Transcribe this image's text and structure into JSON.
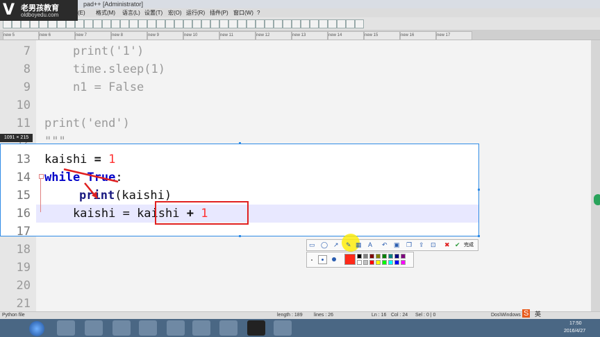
{
  "window": {
    "title": "pad++ [Administrator]"
  },
  "logo": {
    "mark": "V",
    "name": "老男孩教育",
    "url": "oldboyedu.com"
  },
  "menu": [
    "(E)",
    "格式(M)",
    "语言(L)",
    "设置(T)",
    "宏(O)",
    "运行(R)",
    "插件(P)",
    "窗口(W)",
    "?"
  ],
  "tabs": [
    "new 5",
    "new 6",
    "new 7",
    "new 8",
    "new 9",
    "new 10",
    "new 11",
    "new 12",
    "new 13",
    "new 14",
    "new 15",
    "new 16",
    "new 17"
  ],
  "editor": {
    "lines_above": [
      {
        "num": "7",
        "text": "    print('1')"
      },
      {
        "num": "8",
        "text": "    time.sleep(1)"
      },
      {
        "num": "9",
        "text": "    n1 = False"
      },
      {
        "num": "10",
        "text": ""
      },
      {
        "num": "11",
        "text": "print('end')"
      },
      {
        "num": "12",
        "text": "\"\"\""
      }
    ],
    "capture_lines": [
      {
        "num": "13"
      },
      {
        "num": "14"
      },
      {
        "num": "15"
      },
      {
        "num": "16"
      },
      {
        "num": "17"
      }
    ],
    "code13": {
      "a": "kaishi",
      "b": " = ",
      "c": "1"
    },
    "code14": {
      "a": "while",
      "b": " True",
      "c": ":"
    },
    "code15": {
      "a": "print",
      "b": "(kaishi)"
    },
    "code16": {
      "indent": "    kaishi = ",
      "a": "kaishi",
      "b": " + ",
      "c": "1"
    },
    "lines_below": [
      {
        "num": "18"
      },
      {
        "num": "19"
      },
      {
        "num": "20"
      },
      {
        "num": "21"
      }
    ]
  },
  "capture": {
    "size_label": "1091 × 215"
  },
  "snap_toolbar": {
    "done_label": "完成"
  },
  "colors": {
    "accent_blue": "#2e8be6",
    "red_box": "#e02020",
    "palette": [
      "#ff2a1a",
      "#000000",
      "#808080",
      "#800000",
      "#808000",
      "#008000",
      "#008080",
      "#000080",
      "#800080",
      "#ffffff",
      "#c0c0c0",
      "#ff0000",
      "#ffff00",
      "#00ff00",
      "#00ffff",
      "#0000ff",
      "#ff00ff"
    ]
  },
  "statusbar": {
    "file_type": "Python file",
    "length": "length : 189",
    "lines": "lines : 26",
    "ln": "Ln : 16",
    "col": "Col : 24",
    "sel": "Sel : 0 | 0",
    "eol": "Dos\\Windows",
    "ime": "英",
    "time": "17:50",
    "date": "2016/4/27"
  }
}
